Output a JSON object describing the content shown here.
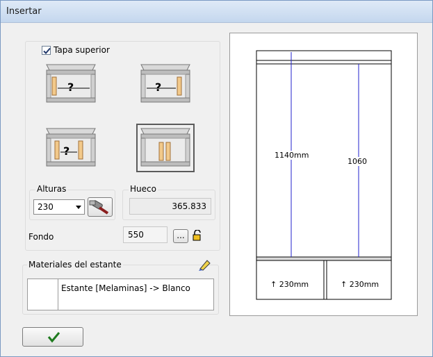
{
  "window": {
    "title": "Insertar"
  },
  "top_cover": {
    "label": "Tapa superior",
    "checked": true
  },
  "cabinet_options": [
    {
      "name": "cabinet-option-1",
      "selected": false
    },
    {
      "name": "cabinet-option-2",
      "selected": false
    },
    {
      "name": "cabinet-option-3",
      "selected": false
    },
    {
      "name": "cabinet-option-4",
      "selected": true
    }
  ],
  "heights": {
    "label": "Alturas",
    "value": "230"
  },
  "gap": {
    "label": "Hueco",
    "value": "365.833"
  },
  "depth": {
    "label": "Fondo",
    "value": "550",
    "browse_label": "..."
  },
  "materials": {
    "label": "Materiales del estante",
    "item": "Estante [Melaminas] -> Blanco"
  },
  "preview": {
    "dim_left": "1140mm",
    "dim_right": "1060",
    "shelf_left": "↑ 230mm",
    "shelf_right": "↑ 230mm"
  },
  "ok_button": {
    "icon": "check-icon"
  },
  "colors": {
    "accent_line": "#2222cc",
    "check": "#1e7a1e"
  }
}
